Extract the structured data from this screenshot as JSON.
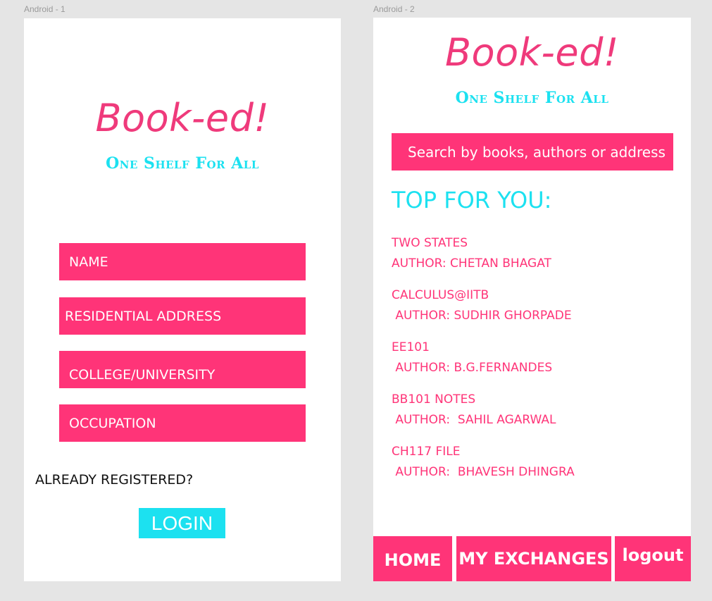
{
  "frames": {
    "android1_label": "Android - 1",
    "android2_label": "Android - 2"
  },
  "brand": {
    "logo": "Book-ed!",
    "tagline": "One Shelf For All"
  },
  "colors": {
    "pink": "#ff3478",
    "cyan": "#1ce1f0",
    "logo_pink": "#ef3a7b"
  },
  "register": {
    "fields": {
      "name": "NAME",
      "address": "RESIDENTIAL ADDRESS",
      "college": "COLLEGE/UNIVERSITY",
      "occupation": "OCCUPATION"
    },
    "already_registered": "ALREADY REGISTERED?",
    "login_label": "LOGIN"
  },
  "home": {
    "search_text": "Search by books, authors or address",
    "top_heading": "TOP FOR YOU:",
    "books": [
      {
        "title": "TWO STATES",
        "author": "AUTHOR: CHETAN BHAGAT"
      },
      {
        "title": "CALCULUS@IITB",
        "author": " AUTHOR: SUDHIR GHORPADE"
      },
      {
        "title": "EE101",
        "author": " AUTHOR: B.G.FERNANDES"
      },
      {
        "title": "BB101 NOTES",
        "author": " AUTHOR:  SAHIL AGARWAL"
      },
      {
        "title": "CH117 FILE",
        "author": " AUTHOR:  BHAVESH DHINGRA"
      }
    ],
    "nav": {
      "home": "HOME",
      "exchanges": "MY EXCHANGES",
      "logout": "logout"
    }
  }
}
